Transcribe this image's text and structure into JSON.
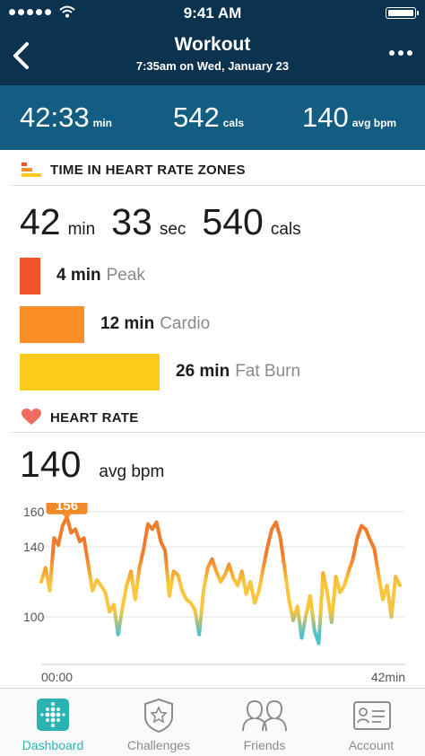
{
  "status_bar": {
    "time": "9:41 AM"
  },
  "header": {
    "title": "Workout",
    "subtitle": "7:35am on Wed, January 23"
  },
  "summary": {
    "duration": {
      "value": "42:33",
      "unit": "min"
    },
    "calories": {
      "value": "542",
      "unit": "cals"
    },
    "heart_rate": {
      "value": "140",
      "unit": "avg bpm"
    }
  },
  "zones_section": {
    "title": "TIME IN HEART RATE ZONES",
    "min_value": "42",
    "min_unit": "min",
    "sec_value": "33",
    "sec_unit": "sec",
    "cals_value": "540",
    "cals_unit": "cals",
    "zones": [
      {
        "minutes": "4 min",
        "name": "Peak",
        "color": "#f0522a",
        "share": 0.15
      },
      {
        "minutes": "12 min",
        "name": "Cardio",
        "color": "#fb8f27",
        "share": 0.46
      },
      {
        "minutes": "26 min",
        "name": "Fat Burn",
        "color": "#fdcb1b",
        "share": 1.0
      }
    ]
  },
  "heart_section": {
    "title": "HEART RATE",
    "avg_value": "140",
    "avg_unit": "avg bpm",
    "peak_badge": "156"
  },
  "chart_data": {
    "type": "line",
    "y_ticks": [
      "160",
      "140",
      "100"
    ],
    "x_ticks": [
      "00:00",
      "42min"
    ],
    "ylim": [
      75,
      162
    ],
    "xlim": [
      0,
      42
    ],
    "colors": {
      "high": "#f27b2b",
      "mid": "#f9c53a",
      "low": "#4cc3cd"
    },
    "series": [
      {
        "x": [
          0,
          0.5,
          1,
          1.5,
          2,
          2.5,
          3,
          3.5,
          4,
          4.5,
          5,
          5.5,
          6,
          6.5,
          7,
          7.5,
          8,
          8.5,
          9,
          9.5,
          10,
          10.5,
          11,
          11.5,
          12,
          12.5,
          13,
          13.5,
          14,
          14.5,
          15,
          15.5,
          16,
          16.5,
          17,
          17.5,
          18,
          18.5,
          19,
          19.5,
          20,
          20.5,
          21,
          21.5,
          22,
          22.5,
          23,
          23.5,
          24,
          24.5,
          25,
          25.5,
          26,
          26.5,
          27,
          27.5,
          28,
          28.5,
          29,
          29.5,
          30,
          30.5,
          31,
          31.5,
          32,
          32.5,
          33,
          33.5,
          34,
          34.5,
          35,
          35.5,
          36,
          36.5,
          37,
          37.5,
          38,
          38.5,
          39,
          39.5,
          40,
          40.5,
          41,
          41.5,
          42
        ],
        "y": [
          120,
          128,
          115,
          145,
          141,
          152,
          157,
          148,
          150,
          143,
          145,
          130,
          115,
          121,
          118,
          114,
          103,
          107,
          90,
          105,
          118,
          126,
          110,
          128,
          139,
          153,
          150,
          154,
          143,
          138,
          112,
          126,
          124,
          115,
          110,
          108,
          104,
          90,
          115,
          128,
          133,
          126,
          120,
          124,
          130,
          122,
          118,
          126,
          113,
          120,
          108,
          115,
          128,
          140,
          150,
          154,
          145,
          128,
          110,
          98,
          106,
          88,
          101,
          112,
          92,
          85,
          125,
          114,
          97,
          123,
          114,
          118,
          126,
          133,
          145,
          152,
          150,
          144,
          139,
          124,
          110,
          118,
          100,
          123,
          118
        ]
      }
    ]
  },
  "tabbar": [
    {
      "label": "Dashboard",
      "active": true
    },
    {
      "label": "Challenges",
      "active": false
    },
    {
      "label": "Friends",
      "active": false
    },
    {
      "label": "Account",
      "active": false
    }
  ]
}
